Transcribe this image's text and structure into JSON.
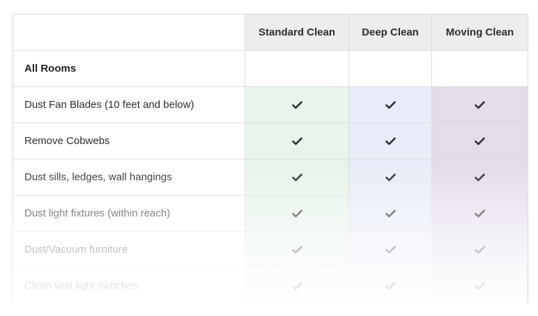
{
  "columns": [
    "Standard Clean",
    "Deep Clean",
    "Moving Clean"
  ],
  "column_colors": {
    "standard": "#e7f4ea",
    "deep": "#e7ecf8",
    "moving": "#e4dbeb",
    "header": "#ededed",
    "check": "#2e2e2e"
  },
  "section": {
    "title": "All Rooms"
  },
  "rows": [
    {
      "task": "Dust Fan Blades (10 feet and below)",
      "standard": "check-icon",
      "deep": "check-icon",
      "moving": "check-icon"
    },
    {
      "task": "Remove Cobwebs",
      "standard": "check-icon",
      "deep": "check-icon",
      "moving": "check-icon"
    },
    {
      "task": "Dust sills, ledges, wall hangings",
      "standard": "check-icon",
      "deep": "check-icon",
      "moving": "check-icon"
    },
    {
      "task": "Dust light fixtures (within reach)",
      "standard": "check-icon",
      "deep": "check-icon",
      "moving": "check-icon"
    },
    {
      "task": "Dust/Vacuum furniture",
      "standard": "check-icon",
      "deep": "check-icon",
      "moving": "check-icon"
    },
    {
      "task": "Clean wall light switches",
      "standard": "check-icon",
      "deep": "check-icon",
      "moving": "check-icon"
    }
  ]
}
